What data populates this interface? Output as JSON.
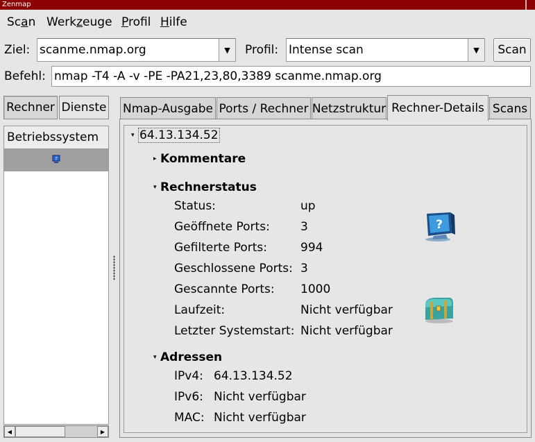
{
  "window": {
    "title": "Zenmap"
  },
  "menu": {
    "items": [
      {
        "pre": "Sc",
        "u": "a",
        "post": "n"
      },
      {
        "pre": "Werk",
        "u": "z",
        "post": "euge"
      },
      {
        "pre": "",
        "u": "P",
        "post": "rofil"
      },
      {
        "pre": "",
        "u": "H",
        "post": "ilfe"
      }
    ]
  },
  "toolbar": {
    "target_label": "Ziel:",
    "target_value": "scanme.nmap.org",
    "profile_label": "Profil:",
    "profile_value": "Intense scan",
    "scan_button": "Scan",
    "command_label": "Befehl:",
    "command_value": "nmap -T4 -A -v -PE -PA21,23,80,3389 scanme.nmap.org"
  },
  "left_pane": {
    "tabs": [
      "Rechner",
      "Dienste"
    ],
    "active_tab": "Rechner",
    "column_header": "Betriebssystem",
    "rows": [
      {
        "icon": "os-unknown-icon"
      }
    ]
  },
  "notebook": {
    "tabs": [
      "Nmap-Ausgabe",
      "Ports / Rechner",
      "Netzstruktur",
      "Rechner-Details",
      "Scans"
    ],
    "active_tab": "Rechner-Details"
  },
  "details": {
    "host": "64.13.134.52",
    "comments_title": "Kommentare",
    "status_title": "Rechnerstatus",
    "status": [
      {
        "key": "Status:",
        "value": "up"
      },
      {
        "key": "Geöffnete Ports:",
        "value": "3"
      },
      {
        "key": "Gefilterte Ports:",
        "value": "994"
      },
      {
        "key": "Geschlossene Ports:",
        "value": "3"
      },
      {
        "key": "Gescannte Ports:",
        "value": "1000"
      },
      {
        "key": "Laufzeit:",
        "value": "Nicht verfügbar"
      },
      {
        "key": "Letzter Systemstart:",
        "value": "Nicht verfügbar"
      }
    ],
    "addresses_title": "Adressen",
    "addresses": [
      {
        "key": "IPv4:",
        "value": "64.13.134.52"
      },
      {
        "key": "IPv6:",
        "value": "Nicht verfügbar"
      },
      {
        "key": "MAC:",
        "value": "Nicht verfügbar"
      }
    ]
  },
  "colors": {
    "titlebar": "#8b0000",
    "background": "#e6e6e6",
    "selected_row": "#a0a0a0"
  }
}
